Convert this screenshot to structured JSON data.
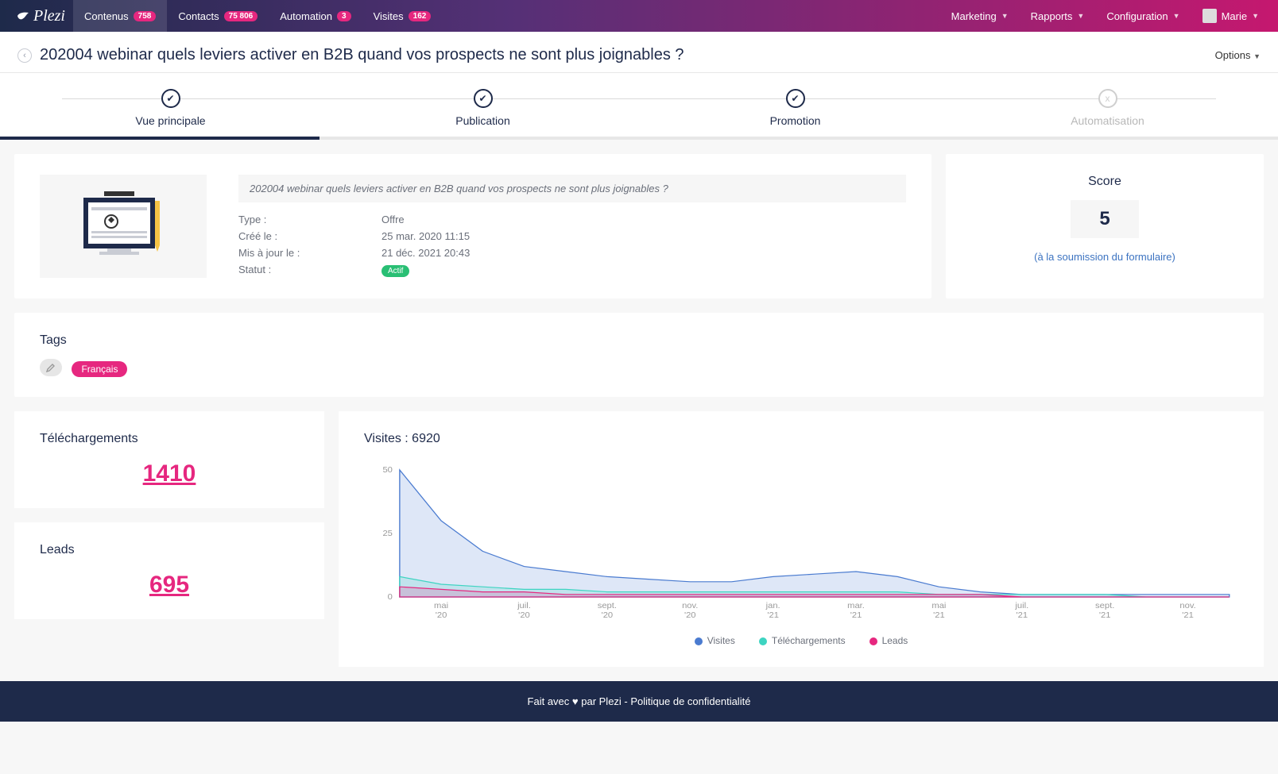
{
  "nav": {
    "brand": "Plezi",
    "items": [
      {
        "label": "Contenus",
        "badge": "758"
      },
      {
        "label": "Contacts",
        "badge": "75 806"
      },
      {
        "label": "Automation",
        "badge": "3"
      },
      {
        "label": "Visites",
        "badge": "162"
      }
    ],
    "right": {
      "marketing": "Marketing",
      "rapports": "Rapports",
      "configuration": "Configuration",
      "user": "Marie"
    }
  },
  "page": {
    "title": "202004 webinar quels leviers activer en B2B quand vos prospects ne sont plus joignables ?",
    "options_label": "Options"
  },
  "stepper": {
    "steps": [
      {
        "label": "Vue principale",
        "done": true
      },
      {
        "label": "Publication",
        "done": true
      },
      {
        "label": "Promotion",
        "done": true
      },
      {
        "label": "Automatisation",
        "done": false,
        "icon": "x"
      }
    ],
    "active_index": 0
  },
  "overview": {
    "title_echo": "202004 webinar quels leviers activer en B2B quand vos prospects ne sont plus joignables ?",
    "fields": {
      "type_label": "Type :",
      "type_value": "Offre",
      "created_label": "Créé le :",
      "created_value": "25 mar. 2020 11:15",
      "updated_label": "Mis à jour le :",
      "updated_value": "21 déc. 2021 20:43",
      "status_label": "Statut :",
      "status_value": "Actif"
    }
  },
  "score": {
    "label": "Score",
    "value": "5",
    "note": "(à la soumission du formulaire)"
  },
  "tags": {
    "heading": "Tags",
    "items": [
      "Français"
    ]
  },
  "stats": {
    "downloads_label": "Téléchargements",
    "downloads_value": "1410",
    "leads_label": "Leads",
    "leads_value": "695"
  },
  "chart": {
    "title": "Visites : 6920",
    "legend": {
      "visites": "Visites",
      "telechargements": "Téléchargements",
      "leads": "Leads"
    },
    "colors": {
      "visites": "#4a7bd0",
      "telechargements": "#3dd4c1",
      "leads": "#e6277f"
    }
  },
  "chart_data": {
    "type": "area",
    "xlabel": "",
    "ylabel": "",
    "ylim": [
      0,
      50
    ],
    "yticks": [
      0,
      25,
      50
    ],
    "categories": [
      "avr. '20",
      "mai '20",
      "juin '20",
      "juil. '20",
      "août '20",
      "sept. '20",
      "oct. '20",
      "nov. '20",
      "déc. '20",
      "jan. '21",
      "févr. '21",
      "mar. '21",
      "avr. '21",
      "mai '21",
      "juin '21",
      "juil. '21",
      "août '21",
      "sept. '21",
      "oct. '21",
      "nov. '21",
      "déc. '21"
    ],
    "xtick_labels": [
      "mai '20",
      "juil. '20",
      "sept. '20",
      "nov. '20",
      "jan. '21",
      "mar. '21",
      "mai '21",
      "juil. '21",
      "sept. '21",
      "nov. '21"
    ],
    "series": [
      {
        "name": "Visites",
        "color": "#4a7bd0",
        "values": [
          50,
          30,
          18,
          12,
          10,
          8,
          7,
          6,
          6,
          8,
          9,
          10,
          8,
          4,
          2,
          1,
          1,
          1,
          1,
          1,
          1
        ]
      },
      {
        "name": "Téléchargements",
        "color": "#3dd4c1",
        "values": [
          8,
          5,
          4,
          3,
          3,
          2,
          2,
          2,
          2,
          2,
          2,
          2,
          2,
          1,
          1,
          1,
          1,
          1,
          0,
          0,
          0
        ]
      },
      {
        "name": "Leads",
        "color": "#e6277f",
        "values": [
          4,
          3,
          2,
          2,
          1,
          1,
          1,
          1,
          1,
          1,
          1,
          1,
          1,
          1,
          1,
          0,
          0,
          0,
          0,
          0,
          0
        ]
      }
    ]
  },
  "footer": {
    "text_left": "Fait avec ",
    "text_mid": " par Plezi - ",
    "privacy": "Politique de confidentialité"
  }
}
